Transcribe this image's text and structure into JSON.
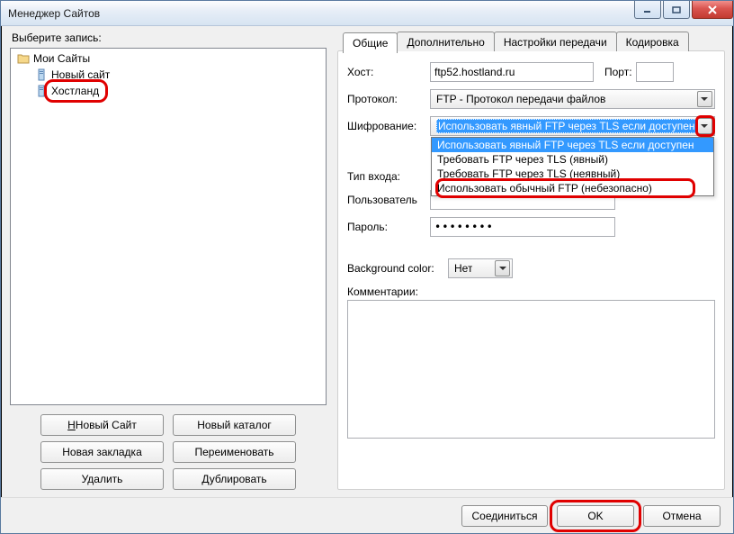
{
  "window": {
    "title": "Менеджер Сайтов"
  },
  "sidebar": {
    "select_label": "Выберите запись:",
    "root": "Мои Сайты",
    "items": [
      {
        "label": "Новый сайт"
      },
      {
        "label": "Хостланд"
      }
    ],
    "buttons": {
      "new_site": "Новый Сайт",
      "new_folder": "Новый каталог",
      "new_bookmark": "Новая закладка",
      "rename": "Переименовать",
      "delete": "Удалить",
      "duplicate": "Дублировать"
    }
  },
  "tabs": {
    "general": "Общие",
    "advanced": "Дополнительно",
    "transfer": "Настройки передачи",
    "charset": "Кодировка"
  },
  "form": {
    "host_label": "Хост:",
    "host_value": "ftp52.hostland.ru",
    "port_label": "Порт:",
    "port_value": "",
    "protocol_label": "Протокол:",
    "protocol_value": "FTP - Протокол передачи файлов",
    "encryption_label": "Шифрование:",
    "encryption_value": "Использовать явный FTP через TLS если доступен",
    "encryption_options": [
      "Использовать явный FTP через TLS если доступен",
      "Требовать FTP через TLS (явный)",
      "Требовать FTP через TLS (неявный)",
      "Использовать обычный FTP (небезопасно)"
    ],
    "logon_type_label": "Тип входа:",
    "user_label": "Пользователь",
    "password_label": "Пароль:",
    "password_value": "••••••••",
    "bgcolor_label": "Background color:",
    "bgcolor_value": "Нет",
    "comments_label": "Комментарии:",
    "comments_value": ""
  },
  "footer": {
    "connect": "Соединиться",
    "ok": "OK",
    "cancel": "Отмена"
  }
}
